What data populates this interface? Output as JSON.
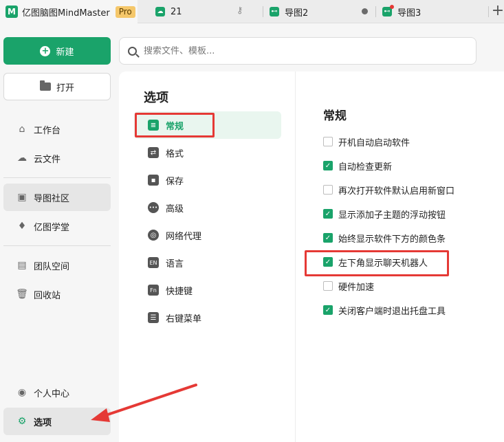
{
  "tabs": {
    "app": {
      "name": "亿图脑图MindMaster",
      "badge": "Pro",
      "logo": "M"
    },
    "files": [
      {
        "label": "21",
        "icon": "cloud-mindmap-icon"
      },
      {
        "label": "导图2",
        "icon": "mindmap-file-icon"
      },
      {
        "label": "导图3",
        "icon": "mindmap-file-icon"
      }
    ],
    "new_tab": "+"
  },
  "sidebar": {
    "new_label": "新建",
    "open_label": "打开",
    "items": [
      {
        "label": "工作台",
        "icon": "workbench-icon"
      },
      {
        "label": "云文件",
        "icon": "cloud-icon"
      },
      {
        "label": "导图社区",
        "icon": "community-icon"
      },
      {
        "label": "亿图学堂",
        "icon": "graduation-cap-icon"
      },
      {
        "label": "团队空间",
        "icon": "team-icon"
      },
      {
        "label": "回收站",
        "icon": "trash-icon"
      },
      {
        "label": "个人中心",
        "icon": "user-icon"
      },
      {
        "label": "选项",
        "icon": "gear-icon"
      }
    ]
  },
  "search": {
    "placeholder": "搜索文件、模板..."
  },
  "options": {
    "title": "选项",
    "categories": [
      {
        "label": "常规",
        "icon": "general-icon",
        "glyph": "≡"
      },
      {
        "label": "格式",
        "icon": "format-icon",
        "glyph": "⇄"
      },
      {
        "label": "保存",
        "icon": "save-icon",
        "glyph": "▪"
      },
      {
        "label": "高级",
        "icon": "more-icon",
        "glyph": "•••"
      },
      {
        "label": "网络代理",
        "icon": "network-icon",
        "glyph": "◎"
      },
      {
        "label": "语言",
        "icon": "language-icon",
        "glyph": "EN"
      },
      {
        "label": "快捷键",
        "icon": "shortcut-icon",
        "glyph": "Fn"
      },
      {
        "label": "右键菜单",
        "icon": "context-menu-icon",
        "glyph": "☰"
      }
    ]
  },
  "general": {
    "title": "常规",
    "settings": [
      {
        "label": "开机自动启动软件",
        "checked": false
      },
      {
        "label": "自动检查更新",
        "checked": true
      },
      {
        "label": "再次打开软件默认启用新窗口",
        "checked": false
      },
      {
        "label": "显示添加子主题的浮动按钮",
        "checked": true
      },
      {
        "label": "始终显示软件下方的颜色条",
        "checked": true
      },
      {
        "label": "左下角显示聊天机器人",
        "checked": true
      },
      {
        "label": "硬件加速",
        "checked": false
      },
      {
        "label": "关闭客户端时退出托盘工具",
        "checked": true
      }
    ]
  },
  "colors": {
    "brand": "#1aa36a",
    "annotation": "#e53935"
  }
}
